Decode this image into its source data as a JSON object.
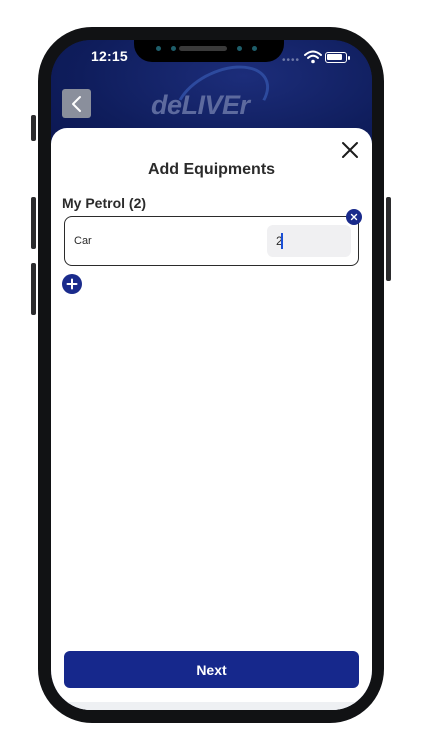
{
  "status_bar": {
    "time": "12:15",
    "signal_icon": "cellular-dots-icon",
    "wifi_icon": "wifi-icon",
    "battery_icon": "battery-icon"
  },
  "header": {
    "back_icon": "chevron-left-icon",
    "logo_text": "deLIVEr"
  },
  "sheet": {
    "close_icon": "close-icon",
    "title": "Add Equipments",
    "section_label": "My Petrol (2)",
    "equipment_rows": [
      {
        "name": "Car",
        "quantity": "2"
      }
    ],
    "remove_icon": "close-icon",
    "add_icon": "plus-icon",
    "next_label": "Next"
  },
  "colors": {
    "brand_navy": "#0f1d5c",
    "primary_button": "#16288c",
    "accent_blue": "#1a2b8c"
  }
}
